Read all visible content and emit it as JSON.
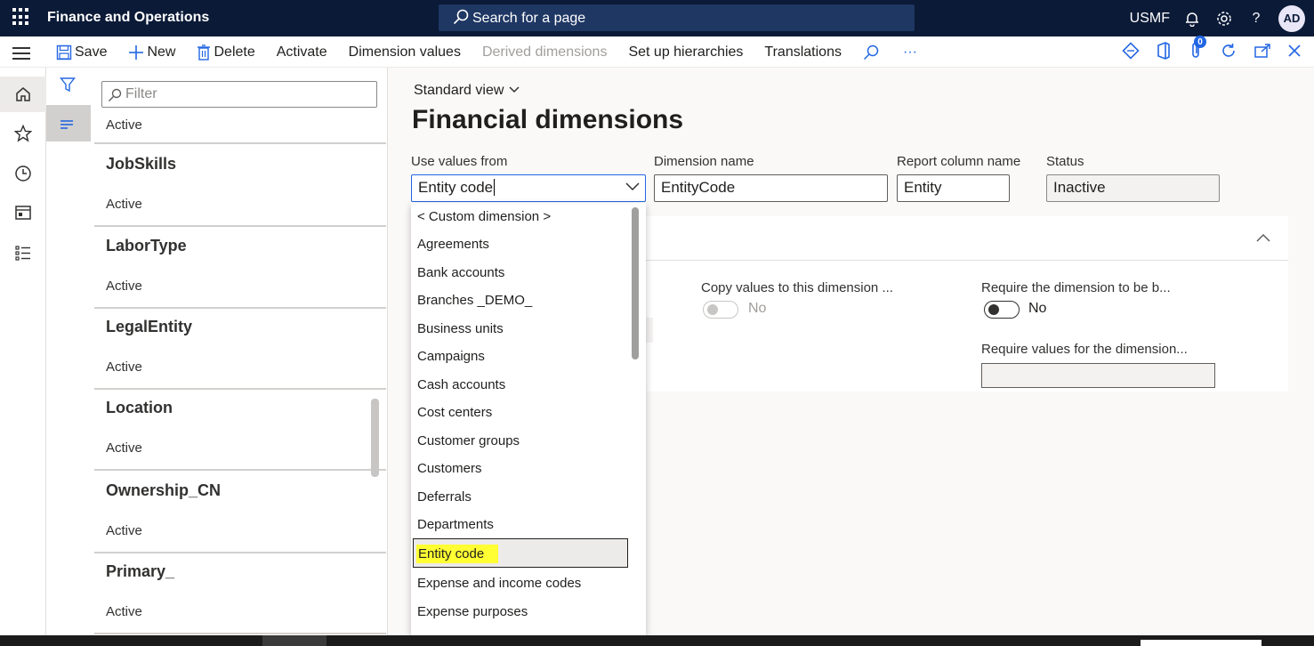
{
  "app": {
    "title": "Finance and Operations",
    "search_placeholder": "Search for a page",
    "company": "USMF",
    "user_initials": "AD"
  },
  "toolbar": {
    "save": "Save",
    "new": "New",
    "delete": "Delete",
    "activate": "Activate",
    "dimension_values": "Dimension values",
    "derived_dimensions": "Derived dimensions",
    "setup_hierarchies": "Set up hierarchies",
    "translations": "Translations",
    "more": "···",
    "attachments_count": "0"
  },
  "list": {
    "filter_placeholder": "Filter",
    "first_status": "Active",
    "items": [
      {
        "name": "JobSkills",
        "status": "Active"
      },
      {
        "name": "LaborType",
        "status": "Active"
      },
      {
        "name": "LegalEntity",
        "status": "Active"
      },
      {
        "name": "Location",
        "status": "Active"
      },
      {
        "name": "Ownership_CN",
        "status": "Active"
      },
      {
        "name": "Primary_",
        "status": "Active"
      }
    ]
  },
  "main": {
    "view_selector": "Standard view",
    "page_title": "Financial dimensions",
    "fields": {
      "use_values_from_label": "Use values from",
      "use_values_from_value": "Entity code",
      "dimension_name_label": "Dimension name",
      "dimension_name_value": "EntityCode",
      "report_column_label": "Report column name",
      "report_column_value": "Entity",
      "status_label": "Status",
      "status_value": "Inactive"
    },
    "fasttab": {
      "copy_values_label": "Copy values to this dimension ...",
      "copy_values_value": "No",
      "require_balanced_label": "Require the dimension to be b...",
      "require_balanced_value": "No",
      "require_values_label": "Require values for the dimension..."
    }
  },
  "dropdown": {
    "options": [
      "< Custom dimension >",
      "Agreements",
      "Bank accounts",
      "Branches _DEMO_",
      "Business units",
      "Campaigns",
      "Cash accounts",
      "Cost centers",
      "Customer groups",
      "Customers",
      "Deferrals",
      "Departments",
      "Entity code",
      "Expense and income codes",
      "Expense purposes"
    ],
    "selected": "Entity code",
    "highlight_color": "#ffff33"
  },
  "colors": {
    "topbar": "#0b1a37",
    "accent": "#2266e3"
  }
}
